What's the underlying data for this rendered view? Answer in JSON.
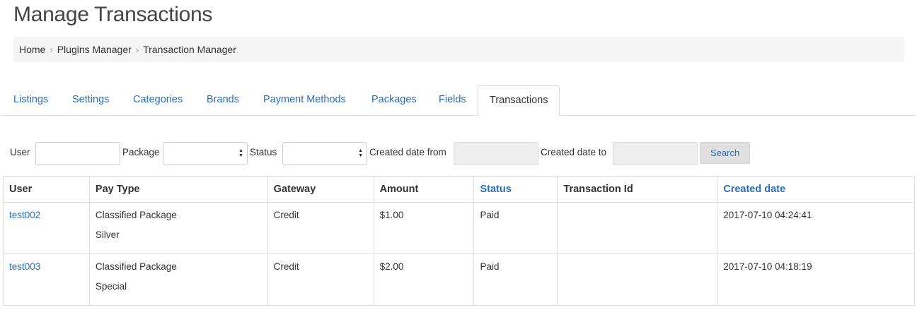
{
  "page": {
    "title": "Manage Transactions"
  },
  "breadcrumb": [
    {
      "label": "Home"
    },
    {
      "label": "Plugins Manager"
    },
    {
      "label": "Transaction Manager"
    }
  ],
  "tabs": [
    {
      "label": "Listings",
      "active": false
    },
    {
      "label": "Settings",
      "active": false
    },
    {
      "label": "Categories",
      "active": false
    },
    {
      "label": "Brands",
      "active": false
    },
    {
      "label": "Payment Methods",
      "active": false
    },
    {
      "label": "Packages",
      "active": false
    },
    {
      "label": "Fields",
      "active": false
    },
    {
      "label": "Transactions",
      "active": true
    }
  ],
  "filters": {
    "user_label": "User",
    "user_value": "",
    "package_label": "Package",
    "package_selected": "",
    "status_label": "Status",
    "status_selected": "",
    "created_from_label": "Created date from",
    "created_from_value": "",
    "created_to_label": "Created date to",
    "created_to_value": "",
    "search_label": "Search"
  },
  "table": {
    "columns": [
      {
        "label": "User",
        "sortable": false
      },
      {
        "label": "Pay Type",
        "sortable": false
      },
      {
        "label": "Gateway",
        "sortable": false
      },
      {
        "label": "Amount",
        "sortable": false
      },
      {
        "label": "Status",
        "sortable": true
      },
      {
        "label": "Transaction Id",
        "sortable": false
      },
      {
        "label": "Created date",
        "sortable": true
      }
    ],
    "rows": [
      {
        "user": "test002",
        "pay_type": "Classified Package",
        "package": "Silver",
        "gateway": "Credit",
        "amount": "$1.00",
        "status": "Paid",
        "transaction_id": "",
        "created": "2017-07-10 04:24:41"
      },
      {
        "user": "test003",
        "pay_type": "Classified Package",
        "package": "Special",
        "gateway": "Credit",
        "amount": "$2.00",
        "status": "Paid",
        "transaction_id": "",
        "created": "2017-07-10 04:18:19"
      }
    ]
  },
  "colors": {
    "link": "#2a6ebb",
    "text": "#333333",
    "border": "#dddddd",
    "breadcrumb_bg": "#f5f5f5"
  },
  "icons": {
    "breadcrumb_separator": "chevron-right-icon",
    "select_arrows": "sort-arrows-icon"
  }
}
